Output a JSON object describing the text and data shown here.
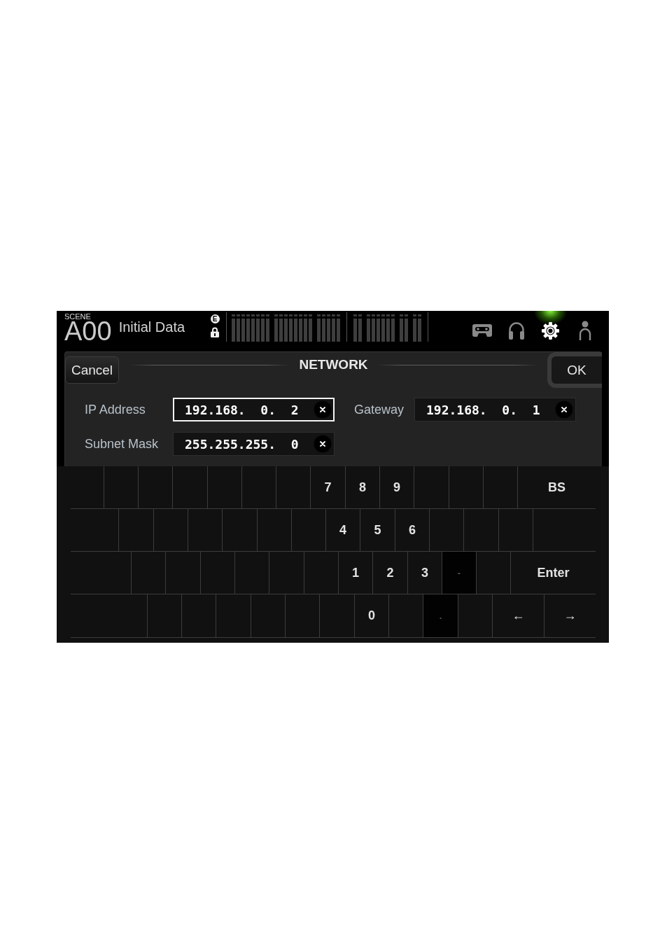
{
  "top_bar": {
    "scene": {
      "caption": "SCENE",
      "number": "A00",
      "name": "Initial Data",
      "badge": "E",
      "locked": true
    },
    "meter_sections": [
      {
        "groups": [
          {
            "meters": [
              {
                "level": 0
              },
              {
                "level": 0
              },
              {
                "level": 0
              },
              {
                "level": 0
              },
              {
                "level": 0
              },
              {
                "level": 0
              },
              {
                "level": 0
              },
              {
                "level": 0
              }
            ]
          },
          {
            "meters": [
              {
                "level": 0
              },
              {
                "level": 0
              },
              {
                "level": 0
              },
              {
                "level": 0
              },
              {
                "level": 0
              },
              {
                "level": 0
              },
              {
                "level": 0
              },
              {
                "level": 0
              }
            ]
          },
          {
            "meters": [
              {
                "level": 0
              },
              {
                "level": 0
              },
              {
                "level": 0
              },
              {
                "level": 0
              },
              {
                "level": 0
              }
            ]
          }
        ]
      },
      {
        "groups": [
          {
            "meters": [
              {
                "level": 0
              },
              {
                "level": 0
              }
            ]
          },
          {
            "meters": [
              {
                "level": 0
              },
              {
                "level": 0
              },
              {
                "level": 0
              },
              {
                "level": 0
              },
              {
                "level": 0
              },
              {
                "level": 0
              }
            ]
          },
          {
            "meters": [
              {
                "level": 0
              },
              {
                "level": 0
              }
            ]
          },
          {
            "meters": [
              {
                "level": 0
              },
              {
                "level": 0
              }
            ]
          }
        ]
      }
    ],
    "toolbar": [
      {
        "kind": "recorder",
        "selected": false
      },
      {
        "kind": "monitor",
        "selected": false
      },
      {
        "kind": "setup",
        "selected": true
      },
      {
        "kind": "user",
        "selected": false
      }
    ]
  },
  "dialog": {
    "cancel": "Cancel",
    "title": "NETWORK",
    "ok": "OK",
    "fields": [
      {
        "label": "IP Address",
        "value": "192.168.  0.  2",
        "selected": true
      },
      {
        "label": "Gateway",
        "value": "192.168.  0.  1",
        "selected": false
      },
      {
        "label": "Subnet Mask",
        "value": "255.255.255.  0",
        "selected": false
      }
    ]
  },
  "keypad": {
    "rows": [
      {
        "keys": [
          {
            "disabled": false
          },
          {
            "disabled": false
          },
          {
            "disabled": false
          },
          {
            "disabled": false
          },
          {
            "disabled": false
          },
          {
            "disabled": false
          },
          {
            "disabled": false
          },
          {
            "label": "7",
            "disabled": false
          },
          {
            "label": "8",
            "disabled": false
          },
          {
            "label": "9",
            "disabled": false
          },
          {
            "disabled": false
          },
          {
            "disabled": false
          },
          {
            "disabled": false
          },
          {
            "label": "BS",
            "disabled": false
          }
        ]
      },
      {
        "keys": [
          {
            "disabled": false
          },
          {
            "disabled": false
          },
          {
            "disabled": false
          },
          {
            "disabled": false
          },
          {
            "disabled": false
          },
          {
            "disabled": false
          },
          {
            "disabled": false
          },
          {
            "label": "4",
            "disabled": false
          },
          {
            "label": "5",
            "disabled": false
          },
          {
            "label": "6",
            "disabled": false
          },
          {
            "disabled": false
          },
          {
            "disabled": false
          },
          {
            "disabled": false
          },
          {
            "disabled": false
          }
        ]
      },
      {
        "keys": [
          {
            "disabled": false
          },
          {
            "disabled": false
          },
          {
            "disabled": false
          },
          {
            "disabled": false
          },
          {
            "disabled": false
          },
          {
            "disabled": false
          },
          {
            "disabled": false
          },
          {
            "label": "1",
            "disabled": false
          },
          {
            "label": "2",
            "disabled": false
          },
          {
            "label": "3",
            "disabled": false
          },
          {
            "label": "-",
            "disabled": true
          },
          {
            "disabled": false
          },
          {
            "label": "Enter",
            "disabled": false
          }
        ]
      },
      {
        "keys": [
          {
            "disabled": false
          },
          {
            "disabled": false
          },
          {
            "disabled": false
          },
          {
            "disabled": false
          },
          {
            "disabled": false
          },
          {
            "disabled": false
          },
          {
            "disabled": false
          },
          {
            "label": "0",
            "disabled": false
          },
          {
            "disabled": false
          },
          {
            "label": ".",
            "disabled": true
          },
          {
            "disabled": false
          },
          {
            "label": "←",
            "disabled": false
          },
          {
            "label": "→",
            "disabled": false
          }
        ]
      }
    ]
  }
}
